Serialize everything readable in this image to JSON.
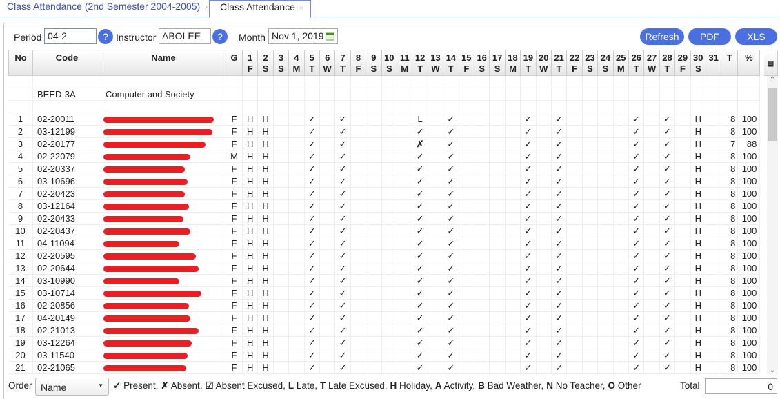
{
  "tabs": [
    {
      "label": "Class Attendance (2nd Semester 2004-2005)",
      "close": "×"
    },
    {
      "label": "Class Attendance",
      "close": "×"
    }
  ],
  "filters": {
    "period_label": "Period",
    "period_value": "04-2",
    "help": "?",
    "instructor_label": "Instructor",
    "instructor_value": "ABOLEE",
    "month_label": "Month",
    "month_value": "Nov 1, 2019",
    "calendar_icon": "calendar-icon"
  },
  "buttons": {
    "refresh": "Refresh",
    "pdf": "PDF",
    "xls": "XLS"
  },
  "columns": {
    "no": "No",
    "code": "Code",
    "name": "Name",
    "g": "G",
    "t": "T",
    "pct": "%",
    "days": [
      [
        "1",
        "F"
      ],
      [
        "2",
        "S"
      ],
      [
        "3",
        "S"
      ],
      [
        "4",
        "M"
      ],
      [
        "5",
        "T"
      ],
      [
        "6",
        "W"
      ],
      [
        "7",
        "T"
      ],
      [
        "8",
        "F"
      ],
      [
        "9",
        "S"
      ],
      [
        "10",
        "S"
      ],
      [
        "11",
        "M"
      ],
      [
        "12",
        "T"
      ],
      [
        "13",
        "W"
      ],
      [
        "14",
        "T"
      ],
      [
        "15",
        "F"
      ],
      [
        "16",
        "S"
      ],
      [
        "17",
        "S"
      ],
      [
        "18",
        "M"
      ],
      [
        "19",
        "T"
      ],
      [
        "20",
        "W"
      ],
      [
        "21",
        "T"
      ],
      [
        "22",
        "F"
      ],
      [
        "23",
        "S"
      ],
      [
        "24",
        "S"
      ],
      [
        "25",
        "M"
      ],
      [
        "26",
        "T"
      ],
      [
        "27",
        "W"
      ],
      [
        "28",
        "T"
      ],
      [
        "29",
        "F"
      ],
      [
        "30",
        "S"
      ],
      [
        "31",
        ""
      ]
    ]
  },
  "section": {
    "code": "BEED-3A",
    "name": "Computer and Society"
  },
  "default_marks": {
    "1": "H",
    "2": "H",
    "5": "✓",
    "7": "✓",
    "12": "✓",
    "14": "✓",
    "19": "✓",
    "21": "✓",
    "26": "✓",
    "28": "✓",
    "30": "H"
  },
  "rows": [
    {
      "no": "1",
      "code": "02-20011",
      "g": "F",
      "t": "8",
      "pct": "100",
      "marks": {
        "12": "L"
      }
    },
    {
      "no": "2",
      "code": "03-12199",
      "g": "F",
      "t": "8",
      "pct": "100"
    },
    {
      "no": "3",
      "code": "02-20177",
      "g": "F",
      "t": "7",
      "pct": "88",
      "marks": {
        "12": "✗"
      }
    },
    {
      "no": "4",
      "code": "02-22079",
      "g": "M",
      "t": "8",
      "pct": "100"
    },
    {
      "no": "5",
      "code": "02-20337",
      "g": "F",
      "t": "8",
      "pct": "100"
    },
    {
      "no": "6",
      "code": "03-10696",
      "g": "F",
      "t": "8",
      "pct": "100"
    },
    {
      "no": "7",
      "code": "02-20423",
      "g": "F",
      "t": "8",
      "pct": "100"
    },
    {
      "no": "8",
      "code": "03-12164",
      "g": "F",
      "t": "8",
      "pct": "100"
    },
    {
      "no": "9",
      "code": "02-20433",
      "g": "F",
      "t": "8",
      "pct": "100"
    },
    {
      "no": "10",
      "code": "02-20437",
      "g": "F",
      "t": "8",
      "pct": "100"
    },
    {
      "no": "11",
      "code": "04-11094",
      "g": "F",
      "t": "8",
      "pct": "100"
    },
    {
      "no": "12",
      "code": "02-20595",
      "g": "F",
      "t": "8",
      "pct": "100"
    },
    {
      "no": "13",
      "code": "02-20644",
      "g": "F",
      "t": "8",
      "pct": "100"
    },
    {
      "no": "14",
      "code": "03-10990",
      "g": "F",
      "t": "8",
      "pct": "100"
    },
    {
      "no": "15",
      "code": "03-10714",
      "g": "F",
      "t": "8",
      "pct": "100"
    },
    {
      "no": "16",
      "code": "02-20856",
      "g": "F",
      "t": "8",
      "pct": "100"
    },
    {
      "no": "17",
      "code": "04-20149",
      "g": "F",
      "t": "8",
      "pct": "100"
    },
    {
      "no": "18",
      "code": "02-21013",
      "g": "F",
      "t": "8",
      "pct": "100"
    },
    {
      "no": "19",
      "code": "03-12264",
      "g": "F",
      "t": "8",
      "pct": "100"
    },
    {
      "no": "20",
      "code": "03-11540",
      "g": "F",
      "t": "8",
      "pct": "100"
    },
    {
      "no": "21",
      "code": "02-21065",
      "g": "F",
      "t": "8",
      "pct": "100"
    }
  ],
  "footer": {
    "order_label": "Order",
    "order_value": "Name",
    "legend": [
      [
        "✓",
        "Present,"
      ],
      [
        "✗",
        "Absent,"
      ],
      [
        "☑",
        "Absent Excused,"
      ],
      [
        "L",
        "Late,"
      ],
      [
        "T",
        "Late Excused,"
      ],
      [
        "H",
        "Holiday,"
      ],
      [
        "A",
        "Activity,"
      ],
      [
        "B",
        "Bad Weather,"
      ],
      [
        "N",
        "No Teacher,"
      ],
      [
        "O",
        "Other"
      ]
    ],
    "total_label": "Total",
    "total_value": "0"
  },
  "colors": {
    "accent": "#4a6fe0",
    "redaction": "#ee1c25"
  }
}
